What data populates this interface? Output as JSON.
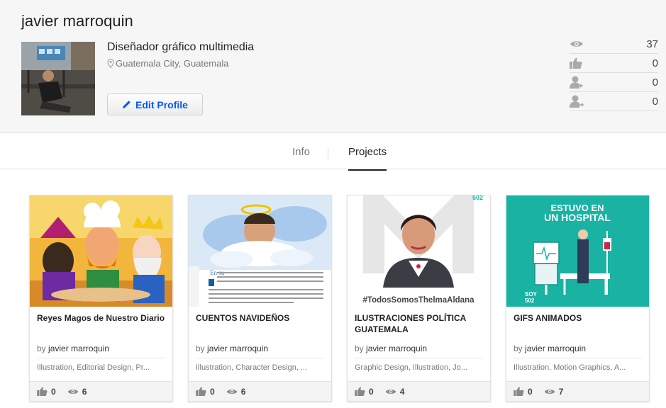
{
  "profile": {
    "name": "javier marroquin",
    "occupation": "Diseñador gráfico multimedia",
    "location": "Guatemala City, Guatemala",
    "edit_label": "Edit Profile"
  },
  "stats": [
    {
      "icon": "eye-icon",
      "value": "37"
    },
    {
      "icon": "thumbs-up-icon",
      "value": "0"
    },
    {
      "icon": "followers-icon",
      "value": "0"
    },
    {
      "icon": "following-icon",
      "value": "0"
    }
  ],
  "tabs": {
    "info": "Info",
    "projects": "Projects",
    "active": "Projects"
  },
  "projects": [
    {
      "title": "Reyes Magos de Nuestro Diario",
      "by": "by",
      "owner": "javier marroquin",
      "fields": "Illustration, Editorial Design, Pr...",
      "appreciations": "0",
      "views": "6"
    },
    {
      "title": "CUENTOS NAVIDEÑOS",
      "by": "by",
      "owner": "javier marroquin",
      "fields": "Illustration, Character Design, ...",
      "appreciations": "0",
      "views": "6"
    },
    {
      "title": "ILUSTRACIONES POLÍTICA GUATEMALA",
      "by": "by",
      "owner": "javier marroquin",
      "fields": "Graphic Design, Illustration, Jo...",
      "appreciations": "0",
      "views": "4",
      "cover_text": "#TodosSomosThelmaAldana"
    },
    {
      "title": "GIFS ANIMADOS",
      "by": "by",
      "owner": "javier marroquin",
      "fields": "Illustration, Motion Graphics, A...",
      "appreciations": "0",
      "views": "7",
      "cover_text": [
        "ESTUVO EN",
        "UN HOSPITAL"
      ]
    }
  ],
  "colors": {
    "accent": "#0057ff",
    "header_bg": "#f6f6f6",
    "teal": "#1ab3a3"
  }
}
